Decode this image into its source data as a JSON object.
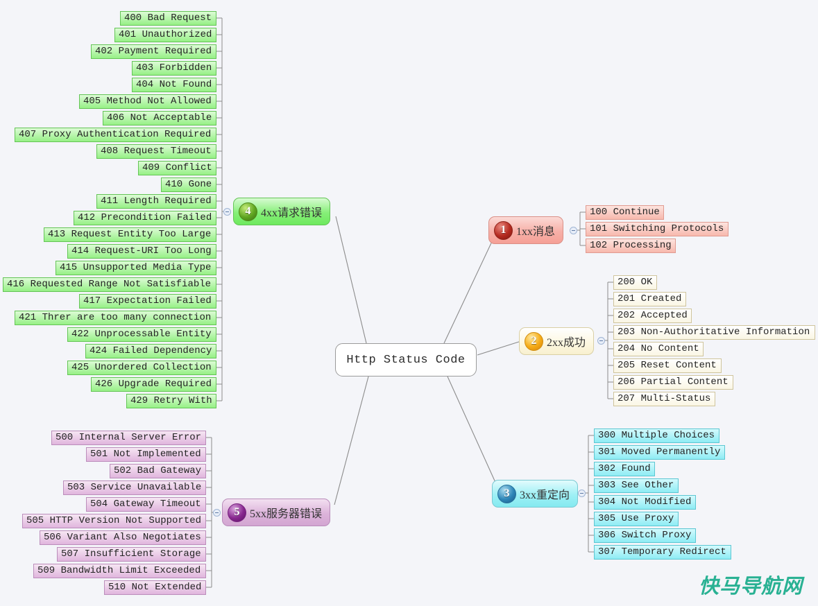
{
  "title": "Http Status Code",
  "background_color": "#f4f5f9",
  "watermark": "快马导航网",
  "center": {
    "label": "Http Status Code"
  },
  "branches": [
    {
      "id": "1xx",
      "badge": "1",
      "label": "1xx消息",
      "color": "#f7b0a8",
      "leaves": [
        "100 Continue",
        "101 Switching Protocols",
        "102 Processing"
      ]
    },
    {
      "id": "2xx",
      "badge": "2",
      "label": "2xx成功",
      "color": "#fdf8e2",
      "leaves": [
        "200 OK",
        "201 Created",
        "202 Accepted",
        "203 Non-Authoritative Information",
        "204 No Content",
        "205 Reset Content",
        "206 Partial Content",
        "207 Multi-Status"
      ]
    },
    {
      "id": "3xx",
      "badge": "3",
      "label": "3xx重定向",
      "color": "#9ef0f5",
      "leaves": [
        "300 Multiple Choices",
        "301 Moved Permanently",
        "302 Found",
        "303 See Other",
        "304 Not Modified",
        "305 Use Proxy",
        "306 Switch Proxy",
        "307 Temporary Redirect"
      ]
    },
    {
      "id": "4xx",
      "badge": "4",
      "label": "4xx请求错误",
      "color": "#86ef78",
      "leaves": [
        "400 Bad Request",
        "401 Unauthorized",
        "402 Payment Required",
        "403 Forbidden",
        "404 Not Found",
        "405 Method Not Allowed",
        "406 Not Acceptable",
        "407 Proxy Authentication Required",
        "408 Request Timeout",
        "409 Conflict",
        "410 Gone",
        "411 Length Required",
        "412 Precondition Failed",
        "413 Request Entity Too Large",
        "414 Request-URI Too Long",
        "415 Unsupported Media Type",
        "416 Requested Range Not Satisfiable",
        "417 Expectation Failed",
        "421 Threr are too many connection",
        "422 Unprocessable Entity",
        "424 Failed Dependency",
        "425 Unordered Collection",
        "426 Upgrade Required",
        "429 Retry With"
      ]
    },
    {
      "id": "5xx",
      "badge": "5",
      "label": "5xx服务器错误",
      "color": "#dcb3da",
      "leaves": [
        "500 Internal Server Error",
        "501 Not Implemented",
        "502 Bad Gateway",
        "503 Service Unavailable",
        "504 Gateway Timeout",
        "505 HTTP Version Not Supported",
        "506 Variant Also Negotiates",
        "507 Insufficient Storage",
        "509 Bandwidth Limit Exceeded",
        "510 Not Extended"
      ]
    }
  ]
}
